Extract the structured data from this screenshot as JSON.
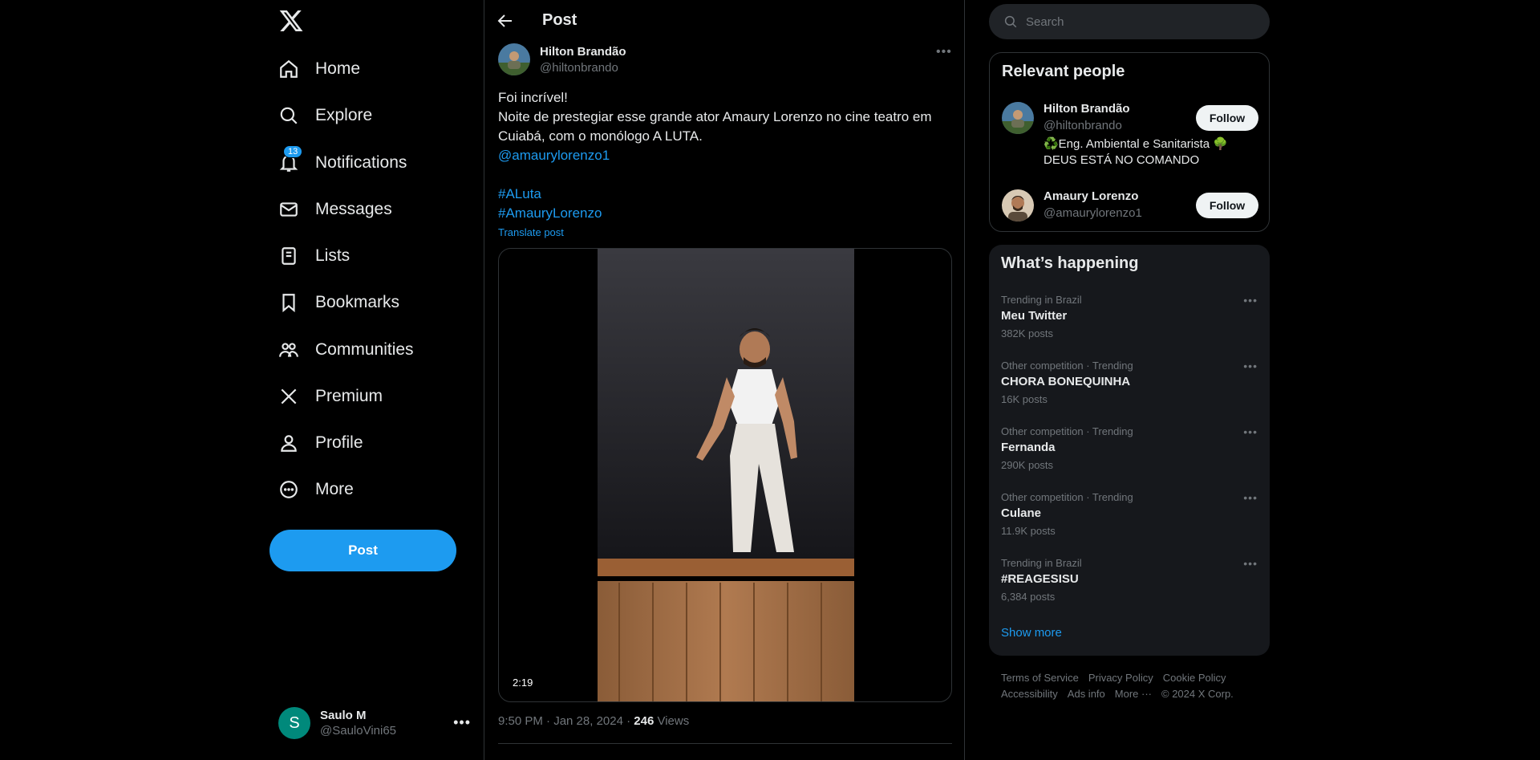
{
  "nav": {
    "items": [
      {
        "label": "Home"
      },
      {
        "label": "Explore"
      },
      {
        "label": "Notifications",
        "badge": "13"
      },
      {
        "label": "Messages"
      },
      {
        "label": "Lists"
      },
      {
        "label": "Bookmarks"
      },
      {
        "label": "Communities"
      },
      {
        "label": "Premium"
      },
      {
        "label": "Profile"
      },
      {
        "label": "More"
      }
    ],
    "post_label": "Post",
    "account": {
      "initial": "S",
      "name": "Saulo M",
      "handle": "@SauloVini65"
    }
  },
  "main": {
    "title": "Post",
    "author": {
      "name": "Hilton Brandão",
      "handle": "@hiltonbrando"
    },
    "text": {
      "line1": "Foi incrível!",
      "line2": "Noite de prestegiar esse grande ator Amaury Lorenzo no cine teatro em Cuiabá, com o monólogo A LUTA.",
      "mention": "@amaurylorenzo1",
      "hashtag1": "#ALuta",
      "hashtag2": "#AmauryLorenzo"
    },
    "translate_label": "Translate post",
    "video_duration": "2:19",
    "meta": {
      "time": "9:50 PM · Jan 28, 2024 · ",
      "views_count": "246",
      "views_label": " Views"
    }
  },
  "right": {
    "search": {
      "placeholder": "Search"
    },
    "people": {
      "title": "Relevant people",
      "list": [
        {
          "name": "Hilton Brandão",
          "handle": "@hiltonbrando",
          "bio": "♻️Eng. Ambiental e Sanitarista 🌳 DEUS ESTÁ NO COMANDO",
          "follow": "Follow"
        },
        {
          "name": "Amaury Lorenzo",
          "handle": "@amaurylorenzo1",
          "bio": "",
          "follow": "Follow"
        }
      ]
    },
    "trends": {
      "title": "What’s happening",
      "list": [
        {
          "context": "Trending in Brazil",
          "name": "Meu Twitter",
          "count": "382K posts"
        },
        {
          "context": "Other competition · Trending",
          "name": "CHORA BONEQUINHA",
          "count": "16K posts"
        },
        {
          "context": "Other competition · Trending",
          "name": "Fernanda",
          "count": "290K posts"
        },
        {
          "context": "Other competition · Trending",
          "name": "Culane",
          "count": "11.9K posts"
        },
        {
          "context": "Trending in Brazil",
          "name": "#REAGESISU",
          "count": "6,384 posts"
        }
      ],
      "show_more": "Show more"
    },
    "footer": {
      "links": [
        "Terms of Service",
        "Privacy Policy",
        "Cookie Policy",
        "Accessibility",
        "Ads info",
        "More ···",
        "© 2024 X Corp."
      ]
    }
  },
  "colors": {
    "accent": "#1d9bf0",
    "background": "#000000",
    "border": "#2f3336",
    "muted": "#71767b",
    "text": "#e7e9ea"
  }
}
